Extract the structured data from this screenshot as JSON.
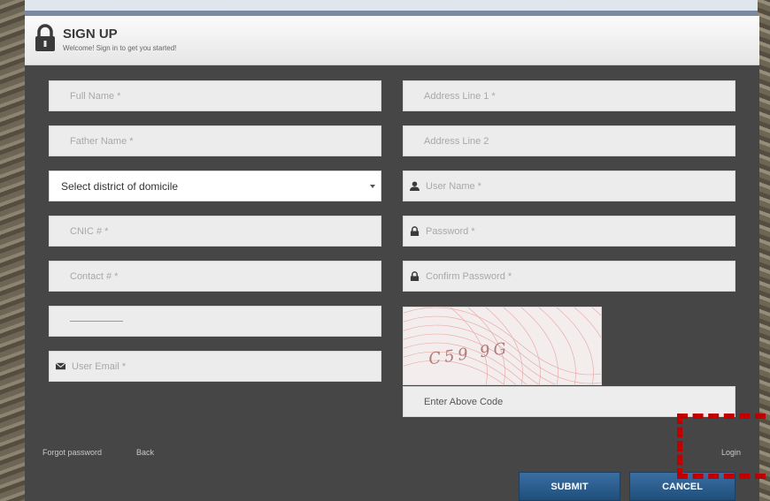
{
  "header": {
    "title": "SIGN UP",
    "subtitle": "Welcome! Sign in to get you started!"
  },
  "left_fields": {
    "full_name": "Full Name *",
    "father_name": "Father Name *",
    "district": "Select district of domicile",
    "cnic": "CNIC # *",
    "contact": "Contact # *",
    "date_placeholder": "__________",
    "email": "User Email *"
  },
  "right_fields": {
    "address1": "Address Line 1 *",
    "address2": "Address Line 2",
    "username": "User Name *",
    "password": "Password *",
    "confirm_password": "Confirm Password *",
    "captcha_text": "C59 9G",
    "captcha_input": "Enter Above Code"
  },
  "links": {
    "forgot": "Forgot password",
    "back": "Back",
    "login": "Login"
  },
  "buttons": {
    "submit": "SUBMIT",
    "cancel": "CANCEL"
  },
  "colors": {
    "panel": "#464646",
    "field": "#ececec",
    "button": "#2a5d8f",
    "highlight": "#c00000"
  },
  "icons": [
    "lock-icon",
    "user-icon",
    "padlock-icon",
    "envelope-icon",
    "chevron-down-icon"
  ]
}
